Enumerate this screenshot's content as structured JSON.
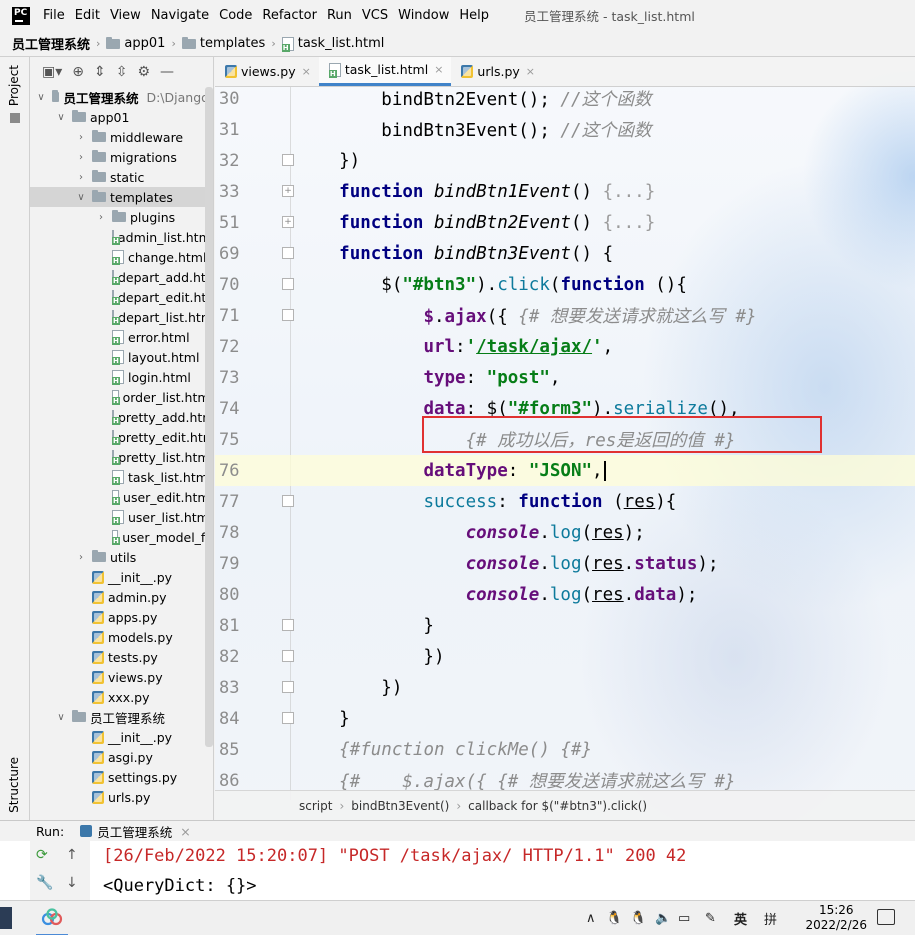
{
  "app": {
    "logo_text": "PC",
    "window_title": "员工管理系统 - task_list.html",
    "menu": [
      "File",
      "Edit",
      "View",
      "Navigate",
      "Code",
      "Refactor",
      "Run",
      "VCS",
      "Window",
      "Help"
    ]
  },
  "breadcrumb": [
    "员工管理系统",
    "app01",
    "templates",
    "task_list.html"
  ],
  "side_tabs": {
    "project": "Project",
    "structure": "Structure"
  },
  "project_tree": {
    "root_label": "员工管理系统",
    "root_path": "D:\\Django\\",
    "app_label": "app01",
    "folders": [
      "middleware",
      "migrations",
      "static",
      "templates"
    ],
    "templates_children": [
      "plugins",
      "admin_list.html",
      "change.html",
      "depart_add.htm",
      "depart_edit.htm",
      "depart_list.htm",
      "error.html",
      "layout.html",
      "login.html",
      "order_list.html",
      "pretty_add.htm",
      "pretty_edit.htm",
      "pretty_list.html",
      "task_list.html",
      "user_edit.html",
      "user_list.html",
      "user_model_fo"
    ],
    "after_templates": [
      "utils"
    ],
    "app_files": [
      "__init__.py",
      "admin.py",
      "apps.py",
      "models.py",
      "tests.py",
      "views.py",
      "xxx.py"
    ],
    "pkg_label": "员工管理系统",
    "pkg_files": [
      "__init__.py",
      "asgi.py",
      "settings.py",
      "urls.py"
    ]
  },
  "editor_tabs": [
    {
      "label": "views.py",
      "type": "py",
      "active": false
    },
    {
      "label": "task_list.html",
      "type": "html",
      "active": true
    },
    {
      "label": "urls.py",
      "type": "py",
      "active": false
    }
  ],
  "code_lines": [
    {
      "n": "30",
      "fold": "",
      "html": "        bindBtn2Event(); <span class='cmt'>//这个函数</span>"
    },
    {
      "n": "31",
      "fold": "",
      "html": "        bindBtn3Event(); <span class='cmt'>//这个函数</span>"
    },
    {
      "n": "32",
      "fold": "-",
      "html": "    })"
    },
    {
      "n": "33",
      "fold": "+",
      "html": "    <span class='kw'>function</span> <span class='fn-i'>bindBtn1Event</span>() <span class='dim'>{...}</span>"
    },
    {
      "n": "51",
      "fold": "+",
      "html": "    <span class='kw'>function</span> <span class='fn-i'>bindBtn2Event</span>() <span class='dim'>{...}</span>"
    },
    {
      "n": "69",
      "fold": "-",
      "html": "    <span class='kw'>function</span> <span class='fn-i'>bindBtn3Event</span>() {"
    },
    {
      "n": "70",
      "fold": "-",
      "html": "        $(<span class='str'>\"#btn3\"</span>).<span class='meth'>click</span>(<span class='kw'>function</span> (){"
    },
    {
      "n": "71",
      "fold": "-",
      "html": "            <span class='prop'>$</span>.<span class='prop'>ajax</span>({ <span class='cmt'>{# 想要发送请求就这么写 #}</span>"
    },
    {
      "n": "72",
      "fold": "",
      "html": "            <span class='prop'>url</span>:<span class='str'>'<span class='ul'>/task/ajax/</span>'</span>,"
    },
    {
      "n": "73",
      "fold": "",
      "html": "            <span class='prop'>type</span>: <span class='str'>\"post\"</span>,"
    },
    {
      "n": "74",
      "fold": "",
      "html": "            <span class='prop'>data</span>: $(<span class='str'>\"#form3\"</span>).<span class='meth'>serialize</span>(),"
    },
    {
      "n": "75",
      "fold": "",
      "html": "                <span class='cmt'>{# 成功以后，res是返回的值 #}</span>"
    },
    {
      "n": "76",
      "fold": "",
      "html": "            <span class='prop'>dataType</span>: <span class='str'>\"JSON\"</span>,<span id='caret'></span>"
    },
    {
      "n": "77",
      "fold": "-",
      "html": "            <span class='meth'>success</span>: <span class='kw'>function</span> (<span class='ul'>res</span>){"
    },
    {
      "n": "78",
      "fold": "",
      "html": "                <span class='obj'>console</span>.<span class='meth'>log</span>(<span class='ul'>res</span>);"
    },
    {
      "n": "79",
      "fold": "",
      "html": "                <span class='obj'>console</span>.<span class='meth'>log</span>(<span class='ul'>res</span>.<span class='prop'>status</span>);"
    },
    {
      "n": "80",
      "fold": "",
      "html": "                <span class='obj'>console</span>.<span class='meth'>log</span>(<span class='ul'>res</span>.<span class='prop'>data</span>);"
    },
    {
      "n": "81",
      "fold": "-",
      "html": "            }"
    },
    {
      "n": "82",
      "fold": "-",
      "html": "            })"
    },
    {
      "n": "83",
      "fold": "-",
      "html": "        })"
    },
    {
      "n": "84",
      "fold": "-",
      "html": "    }"
    },
    {
      "n": "85",
      "fold": "",
      "html": "    <span class='cmt'>{#function clickMe() {#}</span>"
    },
    {
      "n": "86",
      "fold": "",
      "html": "    <span class='cmt'>{#    $.ajax({ {# 想要发送请求就这么写 #}</span>"
    }
  ],
  "current_line": "76",
  "editor_breadcrumb": [
    "script",
    "bindBtn3Event()",
    "callback for $(\"#btn3\").click()"
  ],
  "run_panel": {
    "label": "Run:",
    "config": "员工管理系统",
    "output": [
      "[26/Feb/2022 15:20:07] \"POST /task/ajax/ HTTP/1.1\" 200 42",
      "<QueryDict: {}>"
    ]
  },
  "taskbar": {
    "ime_lang": "英",
    "ime_mode": "拼",
    "time": "15:26",
    "date": "2022/2/26"
  },
  "colors": {
    "accent": "#4083c9",
    "highlight_box": "#e03131"
  }
}
